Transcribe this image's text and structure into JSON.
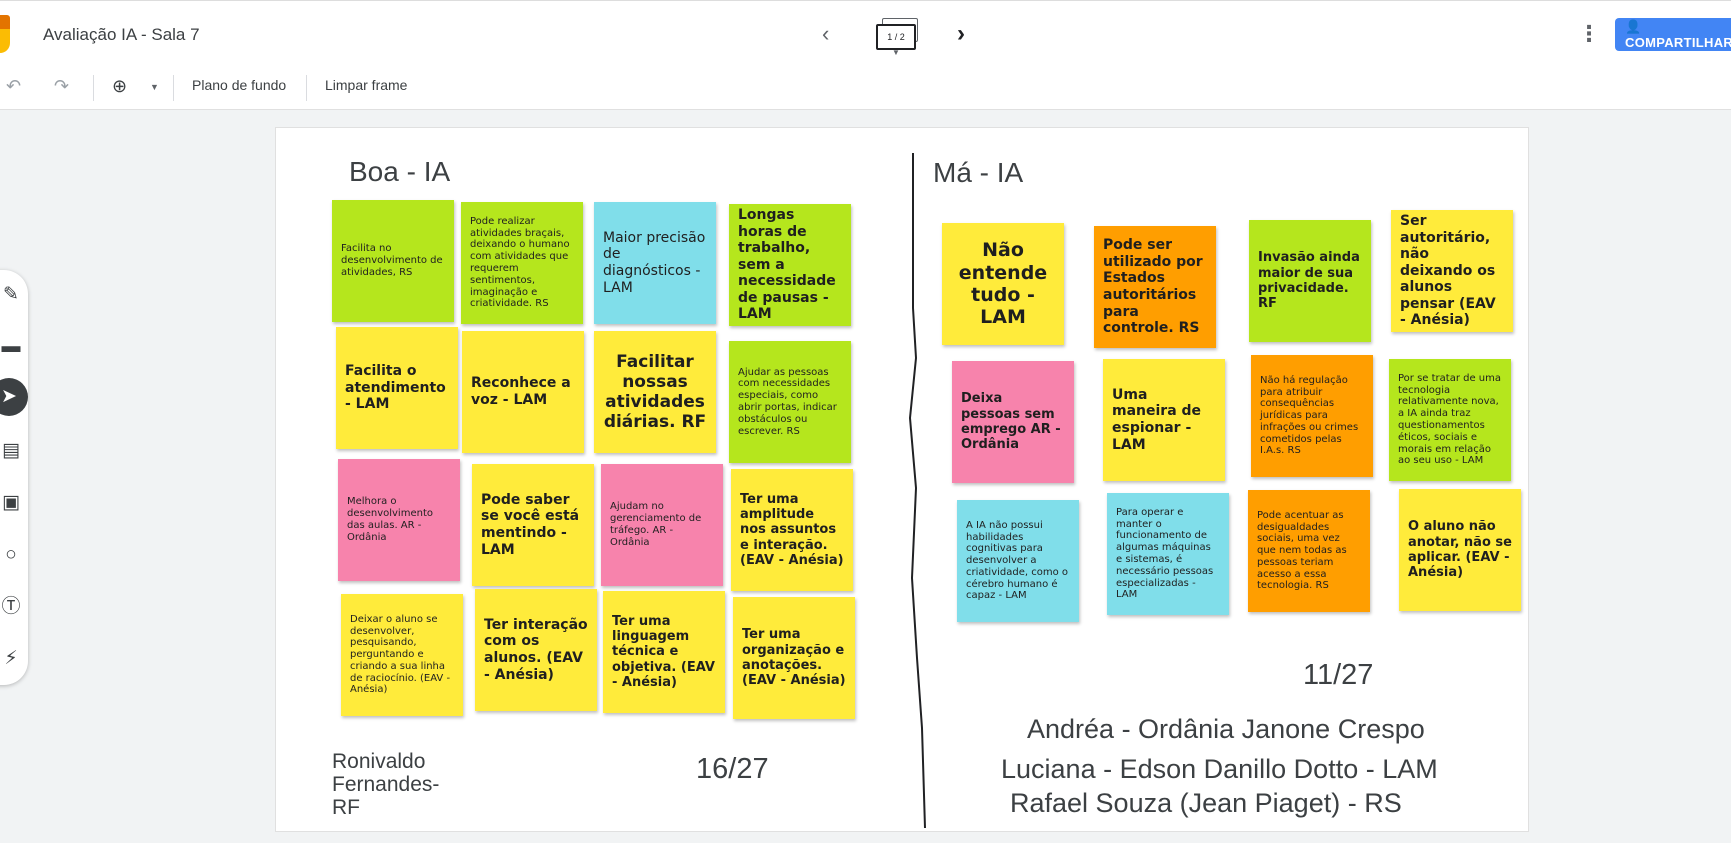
{
  "header": {
    "title": "Avaliação IA - Sala 7",
    "frame_indicator": "1 / 2",
    "share_label": "COMPARTILHAR",
    "colors": {
      "share": "#4285f4",
      "logo_orange": "#e37400",
      "logo_yellow": "#fbbc04"
    }
  },
  "toolbar": {
    "background_label": "Plano de fundo",
    "clear_label": "Limpar frame"
  },
  "sidebar": {
    "tools": [
      "pen-icon",
      "eraser-icon",
      "select-icon",
      "sticky-note-icon",
      "image-icon",
      "circle-icon",
      "text-box-icon",
      "laser-icon"
    ],
    "active_tool": "select-icon"
  },
  "board": {
    "left": {
      "heading": "Boa - IA",
      "score": "16/27",
      "author": "Ronivaldo Fernandes- RF",
      "notes": [
        {
          "text": "Facilita no desenvolvimento de atividades, RS",
          "color": "green"
        },
        {
          "text": "Pode realizar atividades braçais, deixando o humano com atividades que requerem sentimentos, imaginação e criatividade. RS",
          "color": "green"
        },
        {
          "text": "Maior precisão de diagnósticos - LAM",
          "color": "blue"
        },
        {
          "text": "Longas horas de trabalho, sem a necessidade de pausas - LAM",
          "color": "green"
        },
        {
          "text": "Facilita o atendimento - LAM",
          "color": "yellow"
        },
        {
          "text": "Reconhece a voz - LAM",
          "color": "yellow"
        },
        {
          "text": "Facilitar nossas atividades diárias. RF",
          "color": "yellow"
        },
        {
          "text": "Ajudar as pessoas com necessidades especiais, como abrir portas, indicar obstáculos ou escrever. RS",
          "color": "green"
        },
        {
          "text": "Melhora o desenvolvimento das aulas. AR - Ordânia",
          "color": "pink"
        },
        {
          "text": "Pode saber se você está mentindo - LAM",
          "color": "yellow"
        },
        {
          "text": "Ajudam no gerenciamento de tráfego. AR - Ordânia",
          "color": "pink"
        },
        {
          "text": "Ter uma amplitude nos assuntos e interação. (EAV - Anésia)",
          "color": "yellow"
        },
        {
          "text": "Deixar o aluno se desenvolver, pesquisando, perguntando e criando a sua linha de raciocínio. (EAV - Anésia)",
          "color": "yellow"
        },
        {
          "text": "Ter interação com os alunos. (EAV - Anésia)",
          "color": "yellow"
        },
        {
          "text": "Ter uma linguagem técnica e objetiva. (EAV - Anésia)",
          "color": "yellow"
        },
        {
          "text": "Ter uma organização  e anotações. (EAV - Anésia)",
          "color": "yellow"
        }
      ]
    },
    "right": {
      "heading": "Má - IA",
      "score": "11/27",
      "authors": [
        "Andréa - Ordânia Janone Crespo",
        "Luciana - Edson Danillo Dotto - LAM",
        "Rafael Souza (Jean Piaget) - RS"
      ],
      "notes": [
        {
          "text": "Não entende tudo - LAM",
          "color": "yellow"
        },
        {
          "text": "Pode ser utilizado por Estados autoritários para controle. RS",
          "color": "orange"
        },
        {
          "text": "Invasão ainda maior de sua privacidade. RF",
          "color": "green"
        },
        {
          "text": "Ser autoritário, não deixando os alunos pensar (EAV - Anésia)",
          "color": "yellow"
        },
        {
          "text": "Deixa pessoas sem emprego AR - Ordânia",
          "color": "pink"
        },
        {
          "text": "Uma maneira de espionar - LAM",
          "color": "yellow"
        },
        {
          "text": "Não há regulação para atribuir consequências jurídicas para infrações ou crimes cometidos pelas I.A.s. RS",
          "color": "orange"
        },
        {
          "text": "Por se tratar de uma tecnologia relativamente nova, a IA ainda traz questionamentos éticos, sociais e morais em relação ao seu uso - LAM",
          "color": "green"
        },
        {
          "text": "A IA não possui habilidades cognitivas para desenvolver a criatividade, como o cérebro humano é capaz - LAM",
          "color": "blue"
        },
        {
          "text": "Para operar e manter o funcionamento de algumas máquinas e sistemas, é necessário pessoas especializadas - LAM",
          "color": "blue"
        },
        {
          "text": "Pode acentuar as desigualdades sociais, uma vez que nem todas as pessoas teriam acesso a essa tecnologia. RS",
          "color": "orange"
        },
        {
          "text": "O aluno não anotar, não se aplicar. (EAV - Anésia)",
          "color": "yellow"
        }
      ]
    }
  }
}
